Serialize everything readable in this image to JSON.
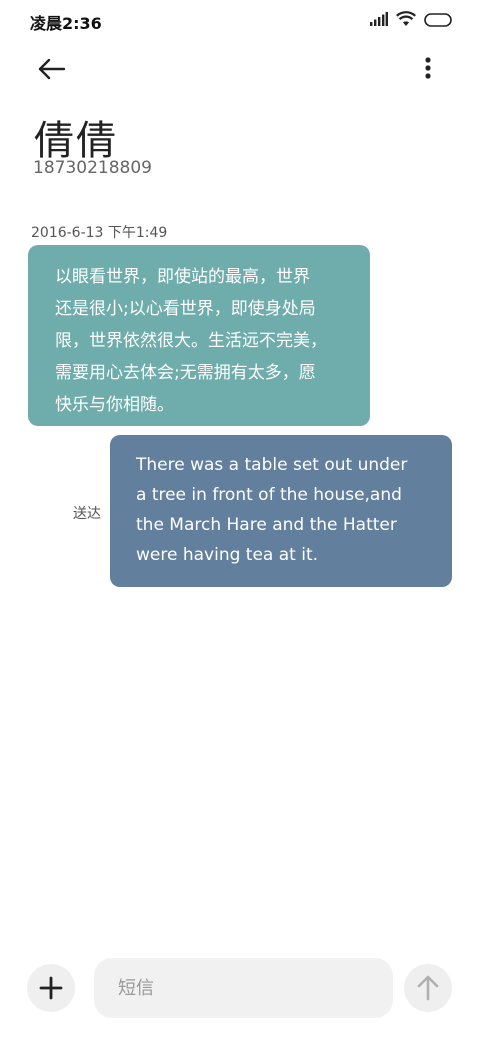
{
  "status_bar": {
    "time": "凌晨2:36",
    "icons": [
      "signal-icon",
      "wifi-icon",
      "battery-icon"
    ]
  },
  "toolbar": {
    "back_icon": "arrow-left-icon",
    "more_icon": "more-vertical-icon"
  },
  "contact": {
    "name": "倩倩",
    "number": "18730218809"
  },
  "conversation": {
    "timestamp": "2016-6-13 下午1:49",
    "messages": [
      {
        "direction": "incoming",
        "color": "#6fadac",
        "text": "以眼看世界，即使站的最高，世界\n还是很小;以心看世界，即使身处局\n限，世界依然很大。生活远不完美，\n需要用心去体会;无需拥有太多，愿\n快乐与你相随。"
      },
      {
        "direction": "outgoing",
        "color": "#627f9e",
        "status": "送达",
        "text": "There was a table set out under\na tree in front of the house,and\nthe March Hare and the Hatter\nwere having tea at it."
      }
    ]
  },
  "composer": {
    "add_icon": "plus-icon",
    "placeholder": "短信",
    "value": "",
    "send_icon": "arrow-up-icon"
  }
}
